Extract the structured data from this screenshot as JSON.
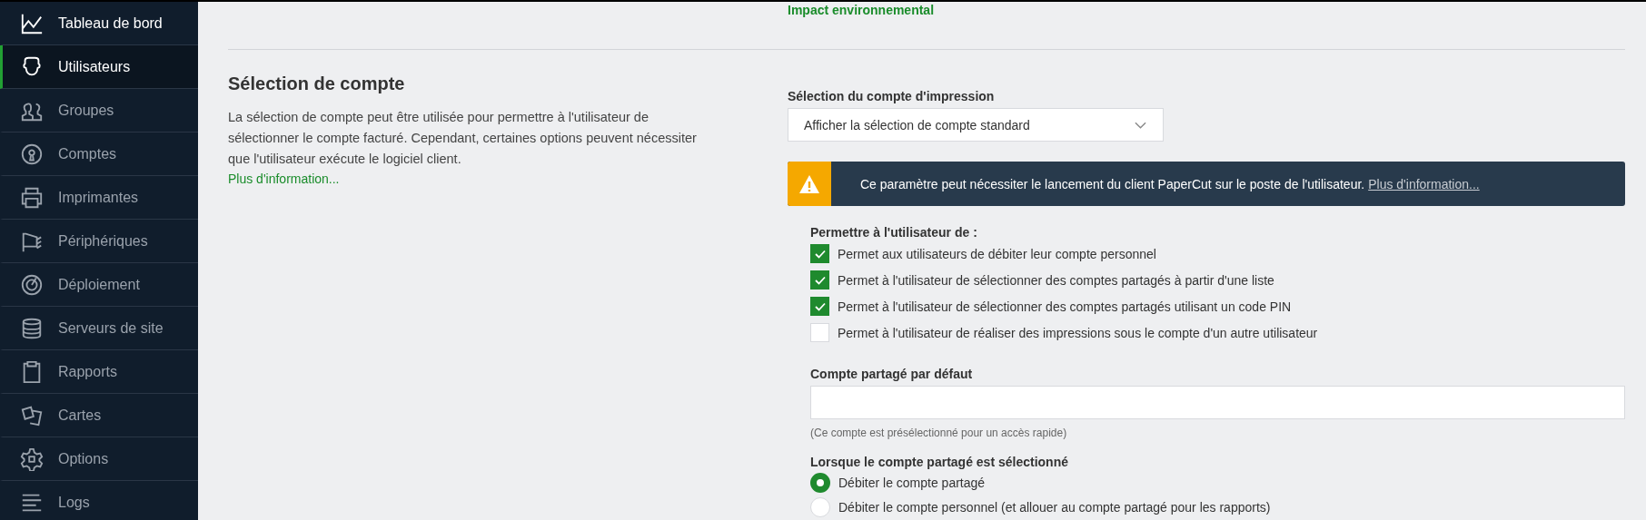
{
  "sidebar": {
    "items": [
      {
        "label": "Tableau de bord",
        "selected": false
      },
      {
        "label": "Utilisateurs",
        "selected": true
      },
      {
        "label": "Groupes",
        "selected": false
      },
      {
        "label": "Comptes",
        "selected": false
      },
      {
        "label": "Imprimantes",
        "selected": false
      },
      {
        "label": "Périphériques",
        "selected": false
      },
      {
        "label": "Déploiement",
        "selected": false
      },
      {
        "label": "Serveurs de site",
        "selected": false
      },
      {
        "label": "Rapports",
        "selected": false
      },
      {
        "label": "Cartes",
        "selected": false
      },
      {
        "label": "Options",
        "selected": false
      },
      {
        "label": "Logs",
        "selected": false
      }
    ]
  },
  "previous_link": "Impact environnemental",
  "section": {
    "title": "Sélection de compte",
    "description": "La sélection de compte peut être utilisée pour permettre à l'utilisateur de sélectionner le compte facturé. Cependant, certaines options peuvent nécessiter que l'utilisateur exécute le logiciel client.",
    "link": "Plus d'information..."
  },
  "print_account_selection": {
    "label": "Sélection du compte d'impression",
    "value": "Afficher la sélection de compte standard"
  },
  "warning": {
    "text": "Ce paramètre peut nécessiter le lancement du client PaperCut sur le poste de l'utilisateur.",
    "link": "Plus d'information..."
  },
  "permissions": {
    "label": "Permettre à l'utilisateur de :",
    "options": [
      {
        "label": "Permet aux utilisateurs de débiter leur compte personnel",
        "checked": true
      },
      {
        "label": "Permet à l'utilisateur de sélectionner des comptes partagés à partir d'une liste",
        "checked": true
      },
      {
        "label": "Permet à l'utilisateur de sélectionner des comptes partagés utilisant un code PIN",
        "checked": true
      },
      {
        "label": "Permet à l'utilisateur de réaliser des impressions sous le compte d'un autre utilisateur",
        "checked": false
      }
    ]
  },
  "default_shared_account": {
    "label": "Compte partagé par défaut",
    "hint": "(Ce compte est présélectionné pour un accès rapide)"
  },
  "when_shared_selected": {
    "label": "Lorsque le compte partagé est sélectionné",
    "options": [
      {
        "label": "Débiter le compte partagé",
        "selected": true
      },
      {
        "label": "Débiter le compte personnel (et allouer au compte partagé pour les rapports)",
        "selected": false
      }
    ]
  }
}
